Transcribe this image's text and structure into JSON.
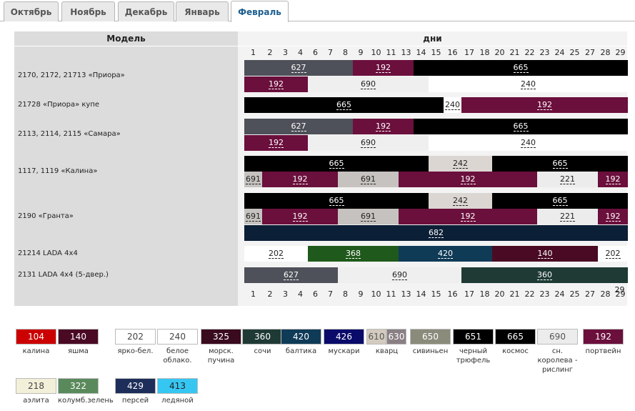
{
  "tabs": [
    "Октябрь",
    "Ноябрь",
    "Декабрь",
    "Январь",
    "Февраль"
  ],
  "active_tab": "Февраль",
  "header": {
    "model": "Модель",
    "days": "дни"
  },
  "days": [
    "1",
    "2",
    "3",
    "4",
    "6",
    "7",
    "8",
    "9",
    "10",
    "11",
    "13",
    "14",
    "15",
    "16",
    "17",
    "18",
    "20",
    "21",
    "22",
    "23",
    "24",
    "25",
    "27",
    "28",
    "29"
  ],
  "last_day": "29",
  "models": [
    {
      "name": "2170, 2172, 21713 «Приора»"
    },
    {
      "name": "21728 «Приора» купе"
    },
    {
      "name": "2113, 2114, 2115 «Самара»"
    },
    {
      "name": "1117, 1119 «Калина»"
    },
    {
      "name": "2190 «Гранта»"
    },
    {
      "name": "21214 LADA 4x4"
    },
    {
      "name": "2131 LADA 4x4 (5-двер.)"
    }
  ],
  "bars": [
    {
      "code": "627",
      "color": "#4e5159",
      "text": "#ffffff",
      "start": 1,
      "end": 8
    },
    {
      "code": "192",
      "color": "#6b0f3c",
      "text": "#ffffff",
      "start": 8,
      "end": 12
    },
    {
      "code": "665",
      "color": "#000000",
      "text": "#ffffff",
      "start": 12,
      "end": 26
    },
    {
      "code": "192",
      "color": "#6b0f3c",
      "text": "#ffffff",
      "start": 1,
      "end": 5
    },
    {
      "code": "690",
      "color": "#efefef",
      "text": "#222222",
      "start": 5,
      "end": 13
    },
    {
      "code": "240",
      "color": "#ffffff",
      "text": "#222222",
      "start": 13,
      "end": 26
    },
    {
      "code": "665",
      "color": "#000000",
      "text": "#ffffff",
      "start": 1,
      "end": 14
    },
    {
      "code": "240",
      "color": "#ffffff",
      "text": "#222222",
      "start": 14,
      "end": 15
    },
    {
      "code": "192",
      "color": "#6b0f3c",
      "text": "#ffffff",
      "start": 15,
      "end": 26
    },
    {
      "code": "627",
      "color": "#4e5159",
      "text": "#ffffff",
      "start": 1,
      "end": 8
    },
    {
      "code": "192",
      "color": "#6b0f3c",
      "text": "#ffffff",
      "start": 8,
      "end": 12
    },
    {
      "code": "665",
      "color": "#000000",
      "text": "#ffffff",
      "start": 12,
      "end": 26
    },
    {
      "code": "192",
      "color": "#6b0f3c",
      "text": "#ffffff",
      "start": 1,
      "end": 5
    },
    {
      "code": "690",
      "color": "#efefef",
      "text": "#222222",
      "start": 5,
      "end": 13
    },
    {
      "code": "240",
      "color": "#ffffff",
      "text": "#222222",
      "start": 13,
      "end": 26
    },
    {
      "code": "665",
      "color": "#000000",
      "text": "#ffffff",
      "start": 1,
      "end": 13
    },
    {
      "code": "242",
      "color": "#dcd6d3",
      "text": "#222222",
      "start": 13,
      "end": 17
    },
    {
      "code": "665",
      "color": "#000000",
      "text": "#ffffff",
      "start": 17,
      "end": 26
    },
    {
      "code": "691",
      "color": "#c5c2bf",
      "text": "#222222",
      "start": 1,
      "end": 2
    },
    {
      "code": "192",
      "color": "#6b0f3c",
      "text": "#ffffff",
      "start": 2,
      "end": 7
    },
    {
      "code": "691",
      "color": "#c5c2bf",
      "text": "#222222",
      "start": 7,
      "end": 11
    },
    {
      "code": "192",
      "color": "#6b0f3c",
      "text": "#ffffff",
      "start": 11,
      "end": 20
    },
    {
      "code": "221",
      "color": "#ececec",
      "text": "#222222",
      "start": 20,
      "end": 24
    },
    {
      "code": "192",
      "color": "#6b0f3c",
      "text": "#ffffff",
      "start": 24,
      "end": 26
    },
    {
      "code": "665",
      "color": "#000000",
      "text": "#ffffff",
      "start": 1,
      "end": 13
    },
    {
      "code": "242",
      "color": "#dcd6d3",
      "text": "#222222",
      "start": 13,
      "end": 17
    },
    {
      "code": "665",
      "color": "#000000",
      "text": "#ffffff",
      "start": 17,
      "end": 26
    },
    {
      "code": "691",
      "color": "#c5c2bf",
      "text": "#222222",
      "start": 1,
      "end": 2
    },
    {
      "code": "192",
      "color": "#6b0f3c",
      "text": "#ffffff",
      "start": 2,
      "end": 7
    },
    {
      "code": "691",
      "color": "#c5c2bf",
      "text": "#222222",
      "start": 7,
      "end": 11
    },
    {
      "code": "192",
      "color": "#6b0f3c",
      "text": "#ffffff",
      "start": 11,
      "end": 20
    },
    {
      "code": "221",
      "color": "#ececec",
      "text": "#222222",
      "start": 20,
      "end": 24
    },
    {
      "code": "192",
      "color": "#6b0f3c",
      "text": "#ffffff",
      "start": 24,
      "end": 26
    },
    {
      "code": "682",
      "color": "#0b1f36",
      "text": "#ffffff",
      "start": 1,
      "end": 26
    },
    {
      "code": "202",
      "color": "#ffffff",
      "text": "#222222",
      "start": 1,
      "end": 5
    },
    {
      "code": "368",
      "color": "#1f5a1c",
      "text": "#ffffff",
      "start": 5,
      "end": 11
    },
    {
      "code": "420",
      "color": "#0f3b57",
      "text": "#ffffff",
      "start": 11,
      "end": 17
    },
    {
      "code": "140",
      "color": "#4a0a23",
      "text": "#ffffff",
      "start": 17,
      "end": 24
    },
    {
      "code": "202",
      "color": "#ffffff",
      "text": "#222222",
      "start": 24,
      "end": 26
    },
    {
      "code": "627",
      "color": "#4e5159",
      "text": "#ffffff",
      "start": 1,
      "end": 7
    },
    {
      "code": "690",
      "color": "#efefef",
      "text": "#222222",
      "start": 7,
      "end": 15
    },
    {
      "code": "360",
      "color": "#1f3a35",
      "text": "#ffffff",
      "start": 15,
      "end": 26
    }
  ],
  "legend": [
    {
      "code": "104",
      "name": "калина",
      "color": "#cc0000",
      "text": "#ffffff"
    },
    {
      "code": "140",
      "name": "яшма",
      "color": "#4a0a23",
      "text": "#ffffff"
    },
    {
      "code": "202",
      "name": "ярко-бел.",
      "color": "#ffffff",
      "text": "#444444"
    },
    {
      "code": "240",
      "name": "белое облако.",
      "color": "#ffffff",
      "text": "#444444"
    },
    {
      "code": "325",
      "name": "морск. пучина",
      "color": "#3a0a1e",
      "text": "#ffffff"
    },
    {
      "code": "360",
      "name": "сочи",
      "color": "#1f3a35",
      "text": "#ffffff"
    },
    {
      "code": "420",
      "name": "балтика",
      "color": "#0f3b57",
      "text": "#ffffff"
    },
    {
      "code": "426",
      "name": "мускари",
      "color": "#0a0a6b",
      "text": "#ffffff"
    },
    {
      "code": "610/630",
      "name": "кварц",
      "codes": [
        "610",
        "630"
      ],
      "colors": [
        "#d3cbbf",
        "#8a7f83"
      ],
      "texts": [
        "#555555",
        "#ffffff"
      ]
    },
    {
      "code": "650",
      "name": "сивиньен",
      "color": "#8a8b7a",
      "text": "#ffffff"
    },
    {
      "code": "651",
      "name": "черный трюфель",
      "color": "#000000",
      "text": "#ffffff"
    },
    {
      "code": "665",
      "name": "космос",
      "color": "#000000",
      "text": "#ffffff"
    },
    {
      "code": "690",
      "name": "сн. королева - рислинг",
      "color": "#ececec",
      "text": "#555555"
    },
    {
      "code": "192",
      "name": "портвейн",
      "color": "#6b0f3c",
      "text": "#ffffff"
    },
    {
      "code": "218",
      "name": "аэлита",
      "color": "#f3f0d9",
      "text": "#444444"
    },
    {
      "code": "322",
      "name": "колумб.зелень",
      "color": "#5a8a5c",
      "text": "#ffffff"
    },
    {
      "code": "429",
      "name": "персей",
      "color": "#1e2e5a",
      "text": "#ffffff"
    },
    {
      "code": "413",
      "name": "ледяной",
      "color": "#36c6f2",
      "text": "#222222"
    }
  ]
}
